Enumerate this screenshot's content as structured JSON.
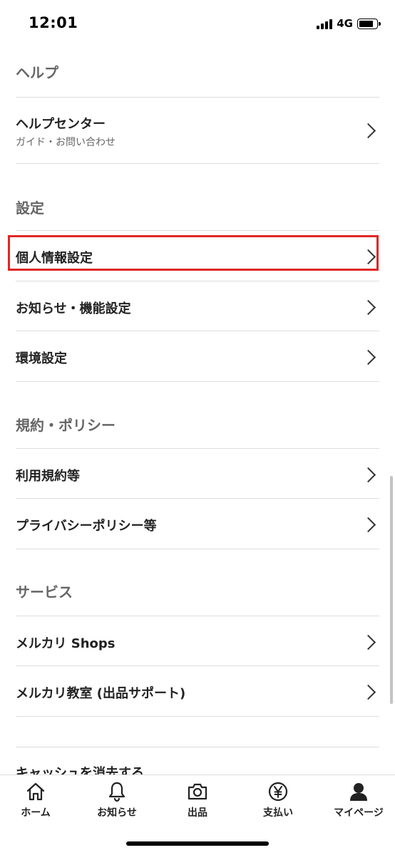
{
  "status_bar": {
    "time": "12:01",
    "network": "4G",
    "battery_level": 0.85
  },
  "sections": {
    "help": {
      "title": "ヘルプ",
      "items": [
        {
          "label": "ヘルプセンター",
          "sub": "ガイド・お問い合わせ"
        }
      ]
    },
    "settings": {
      "title": "設定",
      "items": [
        {
          "label": "個人情報設定"
        },
        {
          "label": "お知らせ・機能設定"
        },
        {
          "label": "環境設定"
        }
      ]
    },
    "policy": {
      "title": "規約・ポリシー",
      "items": [
        {
          "label": "利用規約等"
        },
        {
          "label": "プライバシーポリシー等"
        }
      ]
    },
    "service": {
      "title": "サービス",
      "items": [
        {
          "label": "メルカリ Shops"
        },
        {
          "label": "メルカリ教室 (出品サポート)"
        }
      ]
    },
    "cache": {
      "label": "キャッシュを消去する"
    }
  },
  "tab_bar": {
    "tabs": [
      {
        "label": "ホーム",
        "icon": "home-icon"
      },
      {
        "label": "お知らせ",
        "icon": "bell-icon"
      },
      {
        "label": "出品",
        "icon": "camera-icon"
      },
      {
        "label": "支払い",
        "icon": "yen-icon"
      },
      {
        "label": "マイページ",
        "icon": "person-icon"
      }
    ]
  },
  "colors": {
    "highlight": "#e02626",
    "section_header": "#666666",
    "divider": "#dddddd"
  }
}
